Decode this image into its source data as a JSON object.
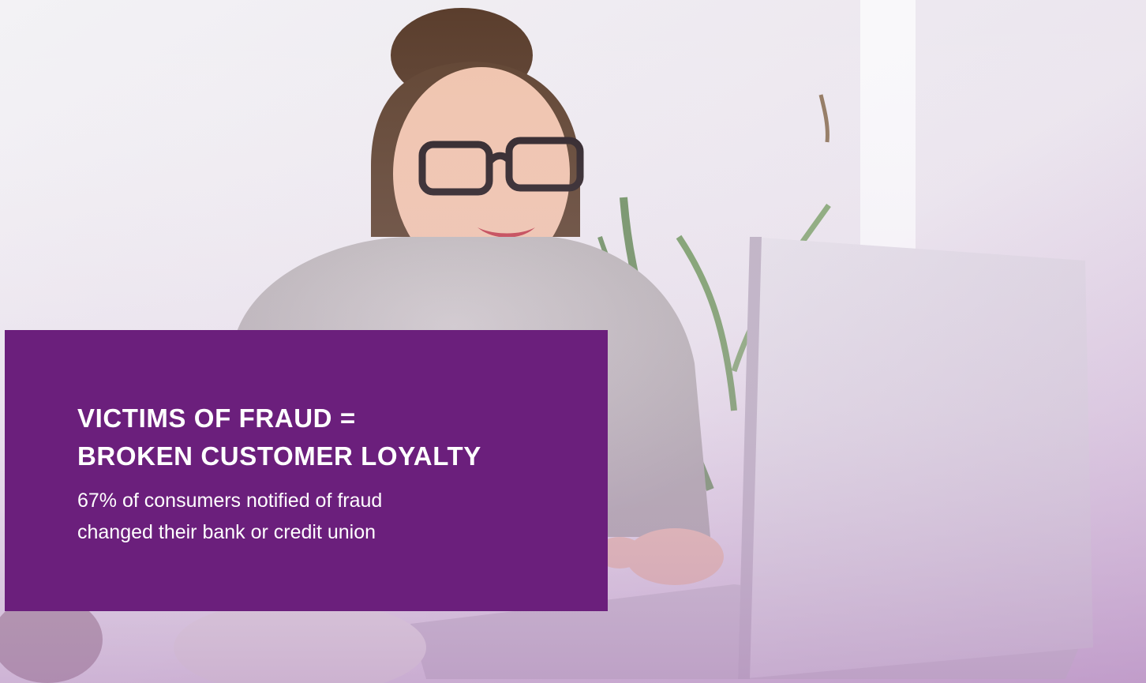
{
  "banner": {
    "headline_line_1": "VICTIMS OF FRAUD =",
    "headline_line_2": "BROKEN CUSTOMER LOYALTY",
    "body_line_1": "67% of consumers notified of fraud",
    "body_line_2": "changed their bank or credit union"
  },
  "photo": {
    "subject": "woman-with-glasses-using-laptop"
  },
  "colors": {
    "panel": "#6b1f7c",
    "text": "#ffffff",
    "photo_tint": "#c9a9cf"
  }
}
